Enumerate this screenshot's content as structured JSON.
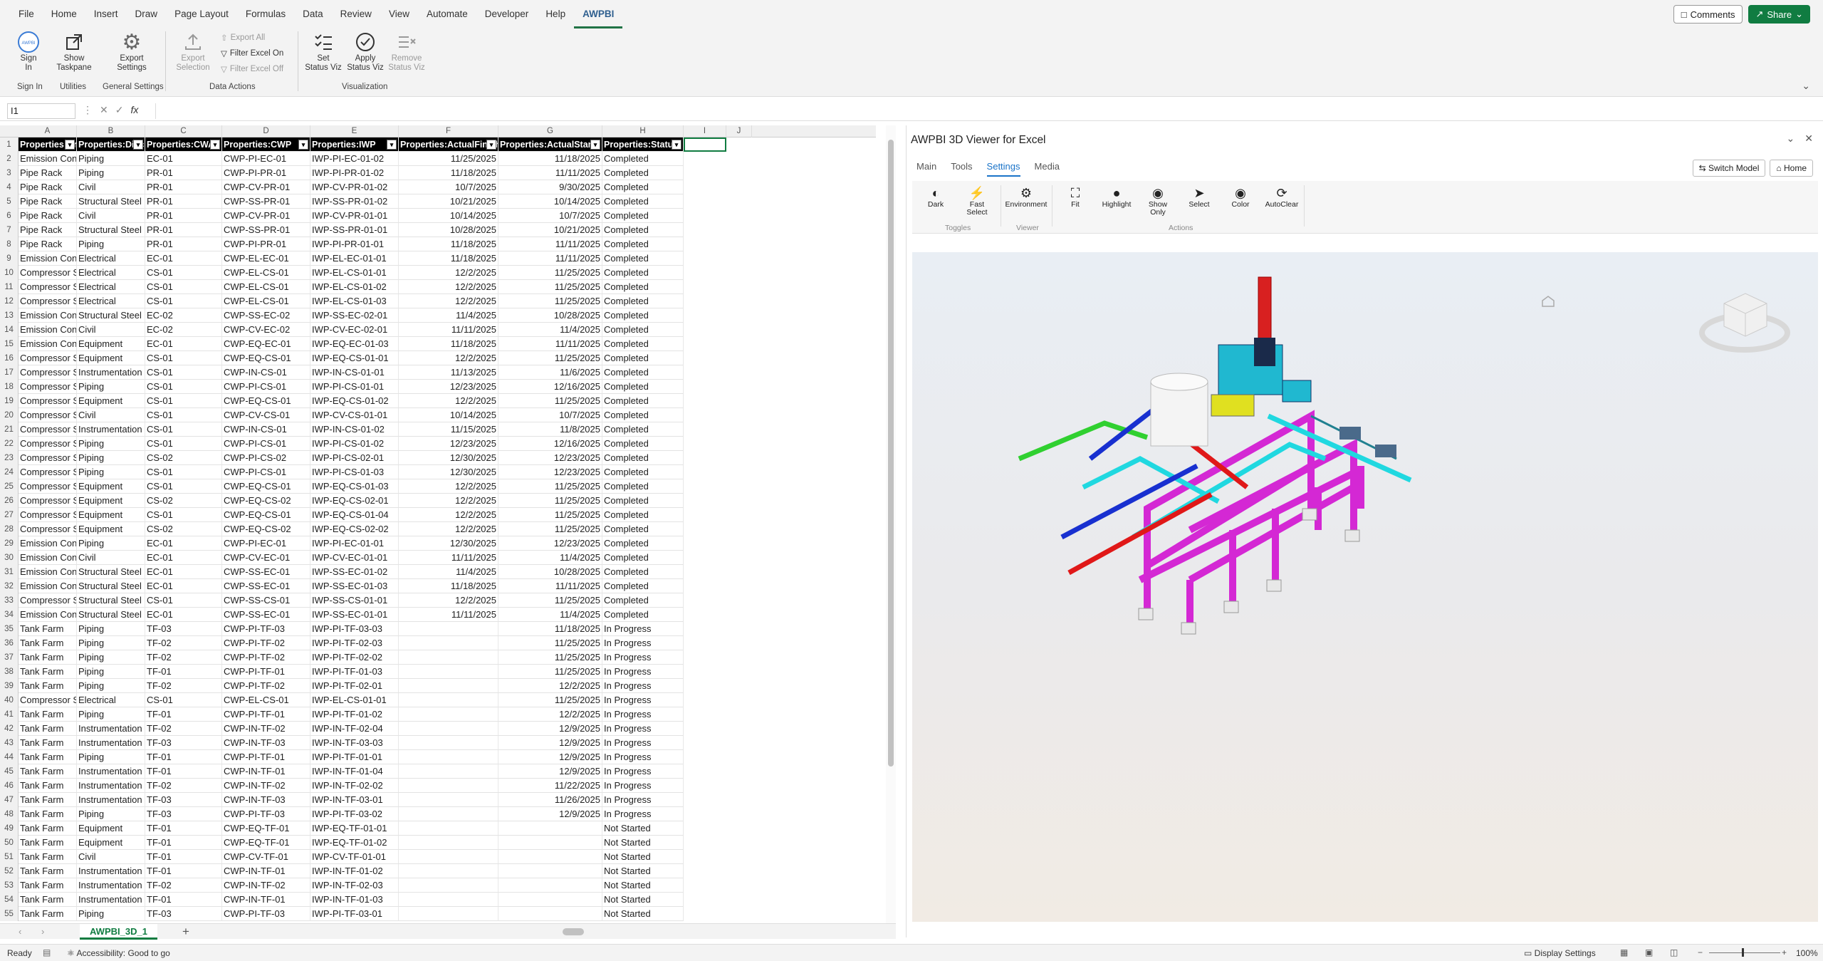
{
  "menubar": {
    "tabs": [
      "File",
      "Home",
      "Insert",
      "Draw",
      "Page Layout",
      "Formulas",
      "Data",
      "Review",
      "View",
      "Automate",
      "Developer",
      "Help",
      "AWPBI"
    ],
    "comments": "Comments",
    "share": "Share"
  },
  "ribbon": {
    "sign_in": [
      "Sign",
      "In"
    ],
    "show_taskpane": [
      "Show",
      "Taskpane"
    ],
    "export_settings": [
      "Export",
      "Settings"
    ],
    "export_selection": [
      "Export",
      "Selection"
    ],
    "export_all": "Export All",
    "filter_on": "Filter Excel On",
    "filter_off": "Filter Excel Off",
    "set_status": [
      "Set",
      "Status Viz"
    ],
    "apply_status": [
      "Apply",
      "Status Viz"
    ],
    "remove_status": [
      "Remove",
      "Status Viz"
    ],
    "groups": {
      "sign_in": "Sign In",
      "utilities": "Utilities",
      "general": "General Settings",
      "data_actions": "Data Actions",
      "visualization": "Visualization"
    }
  },
  "formula": {
    "namebox": "I1",
    "fx": "fx"
  },
  "sheet": {
    "columns": [
      "A",
      "B",
      "C",
      "D",
      "E",
      "F",
      "G",
      "H",
      "I",
      "J"
    ],
    "header": [
      "Properties:Area",
      "Properties:Discipline",
      "Properties:CWA",
      "Properties:CWP",
      "Properties:IWP",
      "Properties:ActualFinish",
      "Properties:ActualStart",
      "Properties:Status"
    ],
    "rows": [
      [
        "Emission Controls",
        "Piping",
        "EC-01",
        "CWP-PI-EC-01",
        "IWP-PI-EC-01-02",
        "11/25/2025",
        "11/18/2025",
        "Completed"
      ],
      [
        "Pipe Rack",
        "Piping",
        "PR-01",
        "CWP-PI-PR-01",
        "IWP-PI-PR-01-02",
        "11/18/2025",
        "11/11/2025",
        "Completed"
      ],
      [
        "Pipe Rack",
        "Civil",
        "PR-01",
        "CWP-CV-PR-01",
        "IWP-CV-PR-01-02",
        "10/7/2025",
        "9/30/2025",
        "Completed"
      ],
      [
        "Pipe Rack",
        "Structural Steel",
        "PR-01",
        "CWP-SS-PR-01",
        "IWP-SS-PR-01-02",
        "10/21/2025",
        "10/14/2025",
        "Completed"
      ],
      [
        "Pipe Rack",
        "Civil",
        "PR-01",
        "CWP-CV-PR-01",
        "IWP-CV-PR-01-01",
        "10/14/2025",
        "10/7/2025",
        "Completed"
      ],
      [
        "Pipe Rack",
        "Structural Steel",
        "PR-01",
        "CWP-SS-PR-01",
        "IWP-SS-PR-01-01",
        "10/28/2025",
        "10/21/2025",
        "Completed"
      ],
      [
        "Pipe Rack",
        "Piping",
        "PR-01",
        "CWP-PI-PR-01",
        "IWP-PI-PR-01-01",
        "11/18/2025",
        "11/11/2025",
        "Completed"
      ],
      [
        "Emission Controls",
        "Electrical",
        "EC-01",
        "CWP-EL-EC-01",
        "IWP-EL-EC-01-01",
        "11/18/2025",
        "11/11/2025",
        "Completed"
      ],
      [
        "Compressor Station",
        "Electrical",
        "CS-01",
        "CWP-EL-CS-01",
        "IWP-EL-CS-01-01",
        "12/2/2025",
        "11/25/2025",
        "Completed"
      ],
      [
        "Compressor Station",
        "Electrical",
        "CS-01",
        "CWP-EL-CS-01",
        "IWP-EL-CS-01-02",
        "12/2/2025",
        "11/25/2025",
        "Completed"
      ],
      [
        "Compressor Station",
        "Electrical",
        "CS-01",
        "CWP-EL-CS-01",
        "IWP-EL-CS-01-03",
        "12/2/2025",
        "11/25/2025",
        "Completed"
      ],
      [
        "Emission Controls",
        "Structural Steel",
        "EC-02",
        "CWP-SS-EC-02",
        "IWP-SS-EC-02-01",
        "11/4/2025",
        "10/28/2025",
        "Completed"
      ],
      [
        "Emission Controls",
        "Civil",
        "EC-02",
        "CWP-CV-EC-02",
        "IWP-CV-EC-02-01",
        "11/11/2025",
        "11/4/2025",
        "Completed"
      ],
      [
        "Emission Controls",
        "Equipment",
        "EC-01",
        "CWP-EQ-EC-01",
        "IWP-EQ-EC-01-03",
        "11/18/2025",
        "11/11/2025",
        "Completed"
      ],
      [
        "Compressor Station",
        "Equipment",
        "CS-01",
        "CWP-EQ-CS-01",
        "IWP-EQ-CS-01-01",
        "12/2/2025",
        "11/25/2025",
        "Completed"
      ],
      [
        "Compressor Station",
        "Instrumentation",
        "CS-01",
        "CWP-IN-CS-01",
        "IWP-IN-CS-01-01",
        "11/13/2025",
        "11/6/2025",
        "Completed"
      ],
      [
        "Compressor Station",
        "Piping",
        "CS-01",
        "CWP-PI-CS-01",
        "IWP-PI-CS-01-01",
        "12/23/2025",
        "12/16/2025",
        "Completed"
      ],
      [
        "Compressor Station",
        "Equipment",
        "CS-01",
        "CWP-EQ-CS-01",
        "IWP-EQ-CS-01-02",
        "12/2/2025",
        "11/25/2025",
        "Completed"
      ],
      [
        "Compressor Station",
        "Civil",
        "CS-01",
        "CWP-CV-CS-01",
        "IWP-CV-CS-01-01",
        "10/14/2025",
        "10/7/2025",
        "Completed"
      ],
      [
        "Compressor Station",
        "Instrumentation",
        "CS-01",
        "CWP-IN-CS-01",
        "IWP-IN-CS-01-02",
        "11/15/2025",
        "11/8/2025",
        "Completed"
      ],
      [
        "Compressor Station",
        "Piping",
        "CS-01",
        "CWP-PI-CS-01",
        "IWP-PI-CS-01-02",
        "12/23/2025",
        "12/16/2025",
        "Completed"
      ],
      [
        "Compressor Station",
        "Piping",
        "CS-02",
        "CWP-PI-CS-02",
        "IWP-PI-CS-02-01",
        "12/30/2025",
        "12/23/2025",
        "Completed"
      ],
      [
        "Compressor Station",
        "Piping",
        "CS-01",
        "CWP-PI-CS-01",
        "IWP-PI-CS-01-03",
        "12/30/2025",
        "12/23/2025",
        "Completed"
      ],
      [
        "Compressor Station",
        "Equipment",
        "CS-01",
        "CWP-EQ-CS-01",
        "IWP-EQ-CS-01-03",
        "12/2/2025",
        "11/25/2025",
        "Completed"
      ],
      [
        "Compressor Station",
        "Equipment",
        "CS-02",
        "CWP-EQ-CS-02",
        "IWP-EQ-CS-02-01",
        "12/2/2025",
        "11/25/2025",
        "Completed"
      ],
      [
        "Compressor Station",
        "Equipment",
        "CS-01",
        "CWP-EQ-CS-01",
        "IWP-EQ-CS-01-04",
        "12/2/2025",
        "11/25/2025",
        "Completed"
      ],
      [
        "Compressor Station",
        "Equipment",
        "CS-02",
        "CWP-EQ-CS-02",
        "IWP-EQ-CS-02-02",
        "12/2/2025",
        "11/25/2025",
        "Completed"
      ],
      [
        "Emission Controls",
        "Piping",
        "EC-01",
        "CWP-PI-EC-01",
        "IWP-PI-EC-01-01",
        "12/30/2025",
        "12/23/2025",
        "Completed"
      ],
      [
        "Emission Controls",
        "Civil",
        "EC-01",
        "CWP-CV-EC-01",
        "IWP-CV-EC-01-01",
        "11/11/2025",
        "11/4/2025",
        "Completed"
      ],
      [
        "Emission Controls",
        "Structural Steel",
        "EC-01",
        "CWP-SS-EC-01",
        "IWP-SS-EC-01-02",
        "11/4/2025",
        "10/28/2025",
        "Completed"
      ],
      [
        "Emission Controls",
        "Structural Steel",
        "EC-01",
        "CWP-SS-EC-01",
        "IWP-SS-EC-01-03",
        "11/18/2025",
        "11/11/2025",
        "Completed"
      ],
      [
        "Compressor Station",
        "Structural Steel",
        "CS-01",
        "CWP-SS-CS-01",
        "IWP-SS-CS-01-01",
        "12/2/2025",
        "11/25/2025",
        "Completed"
      ],
      [
        "Emission Controls",
        "Structural Steel",
        "EC-01",
        "CWP-SS-EC-01",
        "IWP-SS-EC-01-01",
        "11/11/2025",
        "11/4/2025",
        "Completed"
      ],
      [
        "Tank Farm",
        "Piping",
        "TF-03",
        "CWP-PI-TF-03",
        "IWP-PI-TF-03-03",
        "",
        "11/18/2025",
        "In Progress"
      ],
      [
        "Tank Farm",
        "Piping",
        "TF-02",
        "CWP-PI-TF-02",
        "IWP-PI-TF-02-03",
        "",
        "11/25/2025",
        "In Progress"
      ],
      [
        "Tank Farm",
        "Piping",
        "TF-02",
        "CWP-PI-TF-02",
        "IWP-PI-TF-02-02",
        "",
        "11/25/2025",
        "In Progress"
      ],
      [
        "Tank Farm",
        "Piping",
        "TF-01",
        "CWP-PI-TF-01",
        "IWP-PI-TF-01-03",
        "",
        "11/25/2025",
        "In Progress"
      ],
      [
        "Tank Farm",
        "Piping",
        "TF-02",
        "CWP-PI-TF-02",
        "IWP-PI-TF-02-01",
        "",
        "12/2/2025",
        "In Progress"
      ],
      [
        "Compressor Station",
        "Electrical",
        "CS-01",
        "CWP-EL-CS-01",
        "IWP-EL-CS-01-01",
        "",
        "11/25/2025",
        "In Progress"
      ],
      [
        "Tank Farm",
        "Piping",
        "TF-01",
        "CWP-PI-TF-01",
        "IWP-PI-TF-01-02",
        "",
        "12/2/2025",
        "In Progress"
      ],
      [
        "Tank Farm",
        "Instrumentation",
        "TF-02",
        "CWP-IN-TF-02",
        "IWP-IN-TF-02-04",
        "",
        "12/9/2025",
        "In Progress"
      ],
      [
        "Tank Farm",
        "Instrumentation",
        "TF-03",
        "CWP-IN-TF-03",
        "IWP-IN-TF-03-03",
        "",
        "12/9/2025",
        "In Progress"
      ],
      [
        "Tank Farm",
        "Piping",
        "TF-01",
        "CWP-PI-TF-01",
        "IWP-PI-TF-01-01",
        "",
        "12/9/2025",
        "In Progress"
      ],
      [
        "Tank Farm",
        "Instrumentation",
        "TF-01",
        "CWP-IN-TF-01",
        "IWP-IN-TF-01-04",
        "",
        "12/9/2025",
        "In Progress"
      ],
      [
        "Tank Farm",
        "Instrumentation",
        "TF-02",
        "CWP-IN-TF-02",
        "IWP-IN-TF-02-02",
        "",
        "11/22/2025",
        "In Progress"
      ],
      [
        "Tank Farm",
        "Instrumentation",
        "TF-03",
        "CWP-IN-TF-03",
        "IWP-IN-TF-03-01",
        "",
        "11/26/2025",
        "In Progress"
      ],
      [
        "Tank Farm",
        "Piping",
        "TF-03",
        "CWP-PI-TF-03",
        "IWP-PI-TF-03-02",
        "",
        "12/9/2025",
        "In Progress"
      ],
      [
        "Tank Farm",
        "Equipment",
        "TF-01",
        "CWP-EQ-TF-01",
        "IWP-EQ-TF-01-01",
        "",
        "",
        "Not Started"
      ],
      [
        "Tank Farm",
        "Equipment",
        "TF-01",
        "CWP-EQ-TF-01",
        "IWP-EQ-TF-01-02",
        "",
        "",
        "Not Started"
      ],
      [
        "Tank Farm",
        "Civil",
        "TF-01",
        "CWP-CV-TF-01",
        "IWP-CV-TF-01-01",
        "",
        "",
        "Not Started"
      ],
      [
        "Tank Farm",
        "Instrumentation",
        "TF-01",
        "CWP-IN-TF-01",
        "IWP-IN-TF-01-02",
        "",
        "",
        "Not Started"
      ],
      [
        "Tank Farm",
        "Instrumentation",
        "TF-02",
        "CWP-IN-TF-02",
        "IWP-IN-TF-02-03",
        "",
        "",
        "Not Started"
      ],
      [
        "Tank Farm",
        "Instrumentation",
        "TF-01",
        "CWP-IN-TF-01",
        "IWP-IN-TF-01-03",
        "",
        "",
        "Not Started"
      ],
      [
        "Tank Farm",
        "Piping",
        "TF-03",
        "CWP-PI-TF-03",
        "IWP-PI-TF-03-01",
        "",
        "",
        "Not Started"
      ]
    ],
    "tab_name": "AWPBI_3D_1"
  },
  "pane": {
    "title": "AWPBI 3D Viewer for Excel",
    "tabs": [
      "Main",
      "Tools",
      "Settings",
      "Media"
    ],
    "switch_model": "Switch Model",
    "home": "Home",
    "tools": [
      [
        "Dark"
      ],
      [
        "Fast",
        "Select"
      ],
      [
        "Environment"
      ],
      [
        "Fit"
      ],
      [
        "Highlight"
      ],
      [
        "Show",
        "Only"
      ],
      [
        "Select"
      ],
      [
        "Color"
      ],
      [
        "AutoClear"
      ]
    ],
    "groups": [
      "Toggles",
      "Viewer",
      "Actions"
    ]
  },
  "status": {
    "ready": "Ready",
    "accessibility": "Accessibility: Good to go",
    "display_settings": "Display Settings",
    "zoom": "100%"
  },
  "colors": {
    "accent": "#217346",
    "magenta": "#e020e0",
    "cyan": "#20d8e0",
    "red": "#e01818",
    "blue": "#1830d0",
    "green": "#30d030"
  }
}
